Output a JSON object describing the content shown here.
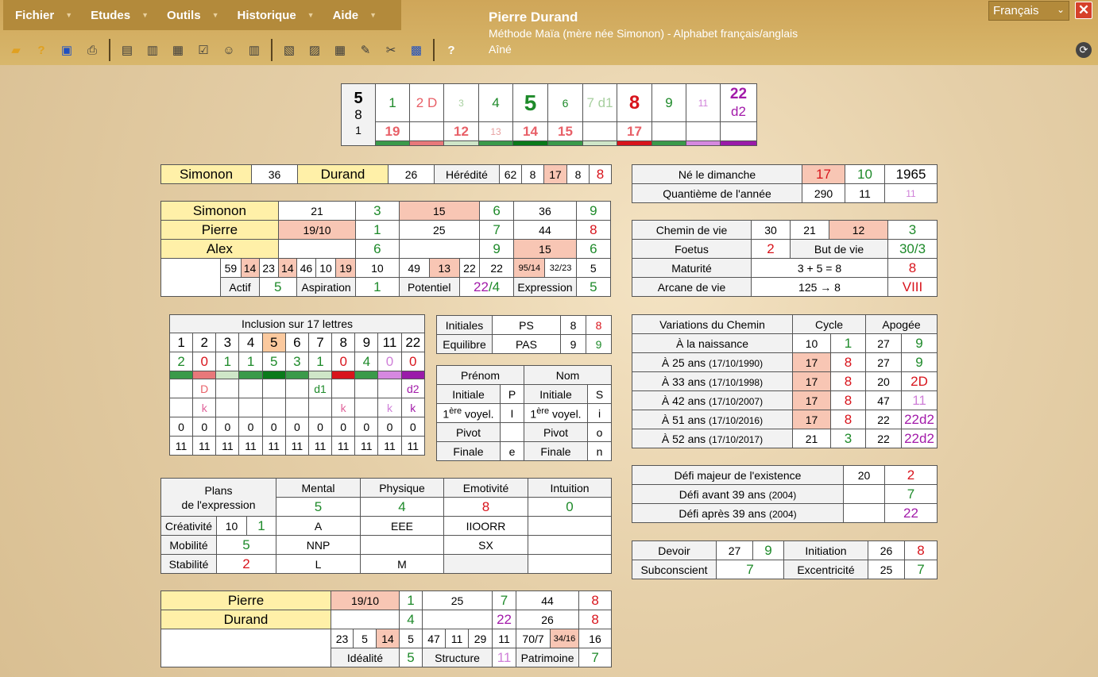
{
  "menu": [
    "Fichier",
    "Etudes",
    "Outils",
    "Historique",
    "Aide"
  ],
  "user": {
    "name": "Pierre Durand",
    "method": "Méthode Maïa (mère née Simonon) - Alphabet français/anglais",
    "rank": "Aîné"
  },
  "language": "Français",
  "toolbar": [
    "open-icon",
    "help-icon",
    "save-icon",
    "print-icon",
    "card-icon",
    "cards-icon",
    "calc-icon",
    "check-icon",
    "people-icon",
    "grid-icon",
    "ab-icon",
    "ap-icon",
    "table-icon",
    "stamp-icon",
    "tools-icon",
    "book-icon",
    "question-icon"
  ],
  "colors": {
    "accent": "#b38a3b",
    "green": "#1e8a2a",
    "red": "#d8141c",
    "purple": "#a21aa9"
  },
  "header": {
    "big": [
      "5",
      "8",
      "1"
    ],
    "top": [
      "1",
      "2 D",
      "3",
      "4",
      "5",
      "6",
      "7 d1",
      "8",
      "9",
      "11",
      "22",
      "d2"
    ],
    "bottom": [
      "19",
      "",
      "12",
      "13",
      "14",
      "15",
      "",
      "17",
      "",
      "",
      "",
      ""
    ]
  },
  "hered": {
    "simonon": "Simonon",
    "v1": "36",
    "durand": "Durand",
    "v2": "26",
    "label": "Hérédité",
    "a": "62",
    "b": "8",
    "c": "17",
    "d": "8",
    "e": "8"
  },
  "names": {
    "r1": [
      "Simonon",
      "21",
      "3",
      "15",
      "6",
      "36",
      "9"
    ],
    "r2": [
      "Pierre",
      "19/10",
      "1",
      "25",
      "7",
      "44",
      "8"
    ],
    "r3": [
      "Alex",
      "",
      "6",
      "",
      "9",
      "15",
      "6"
    ],
    "r4": [
      "59",
      "14",
      "23",
      "14",
      "46",
      "10",
      "19",
      "10",
      "49",
      "13",
      "22",
      "22",
      "95/14",
      "32/23",
      "5"
    ],
    "r5": [
      "Actif",
      "5",
      "Aspiration",
      "1",
      "Potentiel",
      "22",
      "/4",
      "Expression",
      "5"
    ]
  },
  "birth": {
    "r1": [
      "Né le dimanche",
      "17",
      "10",
      "1965"
    ],
    "r2": [
      "Quantième de l'année",
      "290",
      "11",
      "11"
    ]
  },
  "life": {
    "r1": [
      "Chemin de vie",
      "30",
      "21",
      "12",
      "3"
    ],
    "r2": [
      "Foetus",
      "2",
      "But de vie",
      "30/3"
    ],
    "r3": [
      "Maturité",
      "3 + 5 = 8",
      "8"
    ],
    "r4": [
      "Arcane de vie",
      "125 → 8",
      "VIII"
    ]
  },
  "inclusion": {
    "title": "Inclusion sur 17 lettres",
    "nums": [
      "1",
      "2",
      "3",
      "4",
      "5",
      "6",
      "7",
      "8",
      "9",
      "11",
      "22"
    ],
    "counts": [
      "2",
      "0",
      "1",
      "1",
      "5",
      "3",
      "1",
      "0",
      "4",
      "0",
      "0"
    ],
    "r4": [
      "",
      "D",
      "",
      "",
      "",
      "",
      "d1",
      "",
      "",
      "",
      "d2"
    ],
    "r5": [
      "",
      "k",
      "",
      "",
      "",
      "",
      "",
      "k",
      "",
      "k",
      "k"
    ],
    "r6": [
      "0",
      "0",
      "0",
      "0",
      "0",
      "0",
      "0",
      "0",
      "0",
      "0",
      "0"
    ],
    "r7": [
      "11",
      "11",
      "11",
      "11",
      "11",
      "11",
      "11",
      "11",
      "11",
      "11",
      "11"
    ]
  },
  "initials": {
    "r1": [
      "Initiales",
      "PS",
      "8",
      "8"
    ],
    "r2": [
      "Equilibre",
      "PAS",
      "9",
      "9"
    ]
  },
  "prenom": {
    "head": [
      "Prénom",
      "Nom"
    ],
    "r1": [
      "Initiale",
      "P",
      "Initiale",
      "S"
    ],
    "r2": [
      "ère",
      "voyel.",
      "I",
      "ère",
      "voyel.",
      "i"
    ],
    "r3": [
      "Pivot",
      "",
      "Pivot",
      "o"
    ],
    "r4": [
      "Finale",
      "e",
      "Finale",
      "n"
    ],
    "one": "1"
  },
  "variations": {
    "head": [
      "Variations du Chemin",
      "Cycle",
      "Apogée"
    ],
    "rows": [
      [
        "À la naissance",
        "",
        "10",
        "1",
        "27",
        "9"
      ],
      [
        "À 25 ans",
        "(17/10/1990)",
        "17",
        "8",
        "27",
        "9"
      ],
      [
        "À 33 ans",
        "(17/10/1998)",
        "17",
        "8",
        "20",
        "2D"
      ],
      [
        "À 42 ans",
        "(17/10/2007)",
        "17",
        "8",
        "47",
        "11"
      ],
      [
        "À 51 ans",
        "(17/10/2016)",
        "17",
        "8",
        "22",
        "22d2"
      ],
      [
        "À 52 ans",
        "(17/10/2017)",
        "21",
        "3",
        "22",
        "22d2"
      ]
    ]
  },
  "plans": {
    "title1": "Plans",
    "title2": "de l'expression",
    "head": [
      "Mental",
      "Physique",
      "Emotivité",
      "Intuition"
    ],
    "vals": [
      "5",
      "4",
      "8",
      "0"
    ],
    "rows": [
      [
        "Créativité",
        "10",
        "1",
        "A",
        "EEE",
        "IIOORR",
        ""
      ],
      [
        "Mobilité",
        "5",
        "NNP",
        "",
        "SX",
        ""
      ],
      [
        "Stabilité",
        "2",
        "L",
        "M",
        "",
        ""
      ]
    ]
  },
  "defi": {
    "r1": [
      "Défi majeur de l'existence",
      "20",
      "2"
    ],
    "r2": [
      "Défi avant 39 ans",
      "(2004)",
      "",
      "7"
    ],
    "r3": [
      "Défi après 39 ans",
      "(2004)",
      "",
      "22"
    ]
  },
  "devoir": {
    "r1": [
      "Devoir",
      "27",
      "9",
      "Initiation",
      "26",
      "8"
    ],
    "r2": [
      "Subconscient",
      "7",
      "Excentricité",
      "25",
      "7"
    ]
  },
  "bottom": {
    "r1": [
      "Pierre",
      "19/10",
      "1",
      "25",
      "7",
      "44",
      "8"
    ],
    "r2": [
      "Durand",
      "",
      "4",
      "22",
      "26",
      "8"
    ],
    "r3": [
      "23",
      "5",
      "14",
      "5",
      "47",
      "11",
      "29",
      "11",
      "70/7",
      "34/16",
      "16"
    ],
    "r4": [
      "Idéalité",
      "5",
      "Structure",
      "11",
      "Patrimoine",
      "7"
    ]
  }
}
